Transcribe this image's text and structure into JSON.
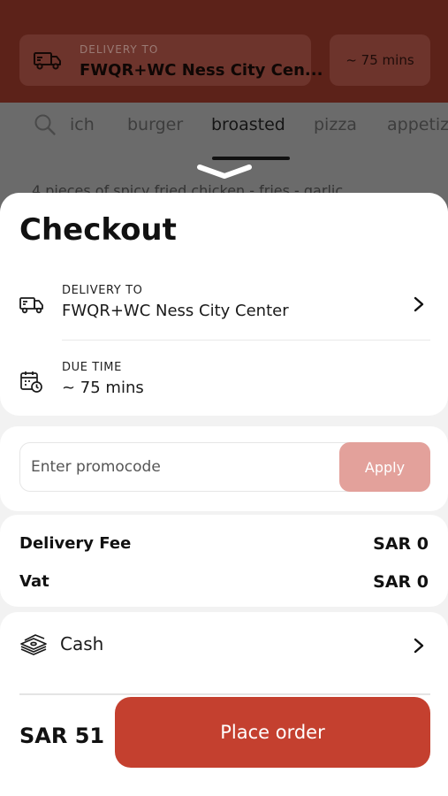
{
  "background": {
    "delivery_label": "DELIVERY TO",
    "delivery_address": "FWQR+WC Ness City Cen...",
    "time": "~ 75 mins",
    "tabs": [
      "ich",
      "burger",
      "broasted",
      "pizza",
      "appetiz"
    ],
    "active_tab": "broasted",
    "description": "4 pieces of spicy fried chicken - fries - garlic"
  },
  "checkout": {
    "title": "Checkout",
    "delivery_label": "DELIVERY TO",
    "delivery_address": "FWQR+WC Ness City Center",
    "due_label": "DUE TIME",
    "due_value": "~ 75 mins",
    "promo_placeholder": "Enter promocode",
    "apply_label": "Apply",
    "fees": [
      {
        "label": "Delivery Fee",
        "value": "SAR 0"
      },
      {
        "label": "Vat",
        "value": "SAR 0"
      }
    ],
    "payment_method": "Cash",
    "total": "SAR 51",
    "place_order_label": "Place order"
  },
  "colors": {
    "brand_red": "#c4402f",
    "apply_disabled": "#e3a19b",
    "header_dimmed": "#5c2219"
  },
  "icons": [
    "truck-icon",
    "search-icon",
    "chevron-down-icon",
    "calendar-clock-icon",
    "chevron-right-icon",
    "cash-icon"
  ]
}
